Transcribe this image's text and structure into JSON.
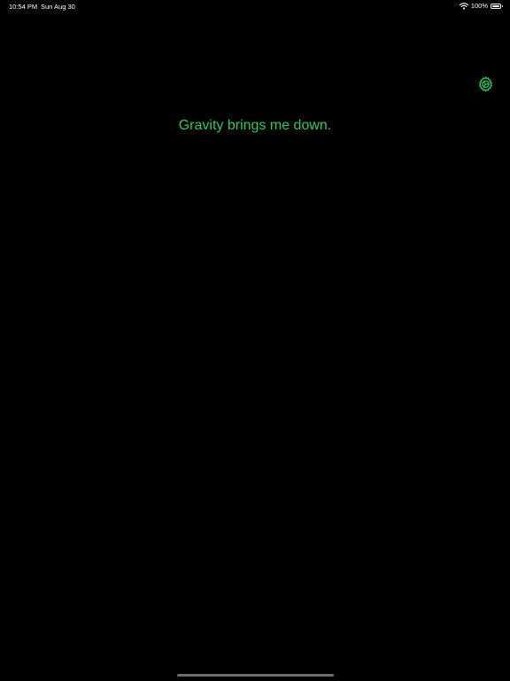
{
  "status_bar": {
    "time": "10:54 PM",
    "date": "Sun Aug 30",
    "battery_percent": "100%",
    "battery_level": 1.0,
    "wifi_icon": "wifi-icon",
    "battery_icon": "battery-icon"
  },
  "toolbar": {
    "settings_icon": "gear-icon"
  },
  "main": {
    "message": "Gravity brings me down."
  },
  "colors": {
    "background": "#000000",
    "accent": "#34c759",
    "status_text": "#ffffff",
    "home_indicator": "#6e6e6e"
  }
}
